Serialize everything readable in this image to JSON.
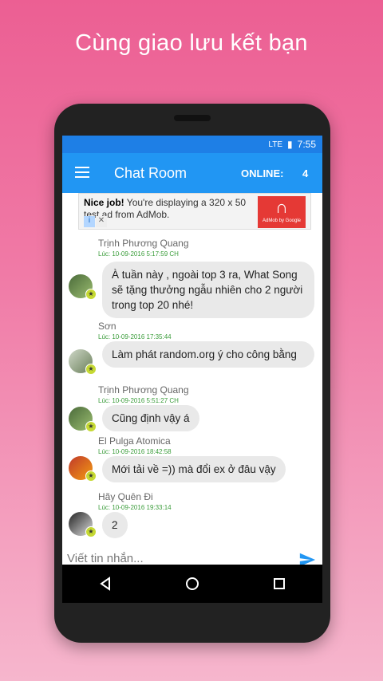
{
  "headline": "Cùng giao lưu kết bạn",
  "status_bar": {
    "time": "7:55",
    "network": "LTE"
  },
  "app_bar": {
    "title": "Chat Room",
    "online_label": "ONLINE:",
    "online_count": "4"
  },
  "ad": {
    "line": "Nice job! You're displaying a 320 x 50 test ad from AdMob.",
    "bold": "Nice job!",
    "rest": "You're displaying a 320 x 50 test ad from AdMob.",
    "brand": "AdMob by Google"
  },
  "messages": [
    {
      "sender": "Trịnh Phương Quang",
      "time": "Lúc: 10-09-2016 5:17:59 CH",
      "text": "À tuần này , ngoài top 3 ra, What Song sẽ  tặng thưởng ngẫu nhiên cho 2 người trong top 20 nhé!"
    },
    {
      "sender": "Sơn",
      "time": "Lúc: 10-09-2016 17:35:44",
      "text": "Làm phát random.org ý cho công bằng"
    },
    {
      "sender": "Trịnh Phương Quang",
      "time": "Lúc: 10-09-2016 5:51:27 CH",
      "text": "Cũng định vậy á"
    },
    {
      "sender": "El Pulga Atomica",
      "time": "Lúc: 10-09-2016 18:42:58",
      "text": "Mới tải về =)) mà đổi ex ở đâu vậy"
    },
    {
      "sender": "Hãy Quên Đi",
      "time": "Lúc: 10-09-2016 19:33:14",
      "text": "2"
    }
  ],
  "composer": {
    "placeholder": "Viết tin nhắn..."
  },
  "colors": {
    "appbar": "#2196f3",
    "accent": "#e94b8a",
    "send": "#2196f3",
    "time": "#3b9d3b"
  },
  "icons": [
    "menu-icon",
    "send-icon",
    "back-icon",
    "home-icon",
    "recents-icon",
    "battery-icon",
    "signal-icon"
  ]
}
